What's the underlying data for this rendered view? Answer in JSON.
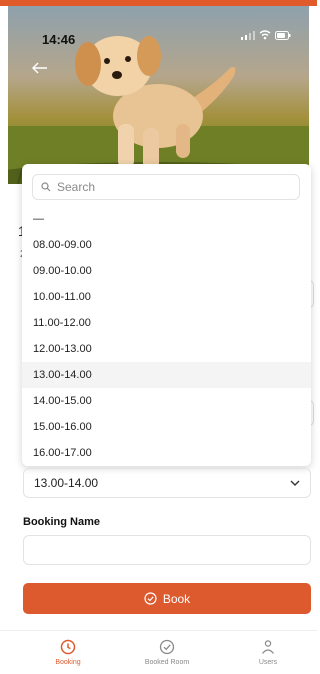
{
  "status_bar": {
    "time": "14:46"
  },
  "dropdown": {
    "search_placeholder": "Search",
    "options": [
      "—",
      "08.00-09.00",
      "09.00-10.00",
      "10.00-11.00",
      "11.00-12.00",
      "12.00-13.00",
      "13.00-14.00",
      "14.00-15.00",
      "15.00-16.00",
      "16.00-17.00"
    ],
    "selected_index": 6
  },
  "form": {
    "time_select_value": "13.00-14.00",
    "booking_name_label": "Booking Name",
    "booking_name_value": "",
    "book_button_label": "Book"
  },
  "bottom_nav": {
    "items": [
      {
        "label": "Booking",
        "icon": "clock-icon",
        "active": true
      },
      {
        "label": "Booked Room",
        "icon": "check-circle-icon",
        "active": false
      },
      {
        "label": "Users",
        "icon": "user-icon",
        "active": false
      }
    ]
  },
  "colors": {
    "accent": "#dd5a2e",
    "inactive": "#8a8a8a"
  },
  "underlay": {
    "title_fragment": "1",
    "subtitle_fragment": "2"
  }
}
